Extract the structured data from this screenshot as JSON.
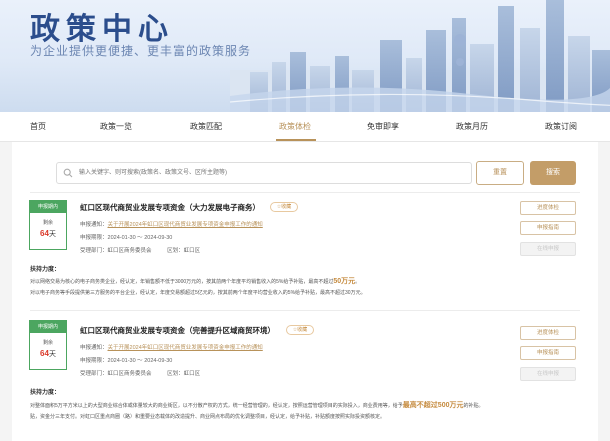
{
  "banner": {
    "title": "政策中心",
    "subtitle": "为企业提供更便捷、更丰富的政策服务"
  },
  "nav": {
    "items": [
      "首页",
      "政策一览",
      "政策匹配",
      "政策体检",
      "免审即享",
      "政策月历",
      "政策订阅"
    ],
    "active_index": 3
  },
  "search": {
    "placeholder": "输入关键字、则可搜索(政策名、政策文号、区所主题等)",
    "reset_label": "重置",
    "search_label": "搜索"
  },
  "policies": [
    {
      "status": "申报期内",
      "countdown_label": "剩余",
      "days": "64",
      "days_unit": "天",
      "title": "虹口区现代商贸业发展专项资金（大力发展电子商务）",
      "fav_label": "☆收藏",
      "notice_label": "申报通知：",
      "notice_link": "关于开展2024年虹口区现代商贸业发展专项资金申报工作的通知",
      "period_label": "申报期限：",
      "period": "2024-01-30 ～ 2024-09-30",
      "dept_label": "受理部门：",
      "dept": "虹口区商务委员会",
      "district_label": "区划：",
      "district": "虹口区",
      "support_label": "扶持力度：",
      "desc_1a": "对以网络交易为核心的电子商务类企业，经认定，年销售额不低于3000万元的，按其前两个年度平均销售收入的5%给予补贴，最高不超过",
      "desc_1b": "50万元",
      "desc_1c": "。",
      "desc_2": "对以电子商务等手段提供第三方服务的平台企业，经认定，年度交易额超过5亿元的，按其前两个年度平均营业收入的5%给予补贴，最高不超过30万元。",
      "buttons": [
        "进度体检",
        "申报指南",
        "在线申报"
      ]
    },
    {
      "status": "申报期内",
      "countdown_label": "剩余",
      "days": "64",
      "days_unit": "天",
      "title": "虹口区现代商贸业发展专项资金（完善提升区域商贸环境）",
      "fav_label": "☆收藏",
      "notice_label": "申报通知：",
      "notice_link": "关于开展2024年虹口区现代商贸业发展专项资金申报工作的通知",
      "period_label": "申报期限：",
      "period": "2024-01-30 ～ 2024-09-30",
      "dept_label": "受理部门：",
      "dept": "虹口区商务委员会",
      "district_label": "区划：",
      "district": "虹口区",
      "support_label": "扶持力度：",
      "desc_1a": "对整体面积5万平方米以上的大型商业综合体或体量较大的商业街区，以不分散产权的方式，统一经营管理的，经认定，按照运营管理项目的实际投入，商业费用等，给予",
      "desc_1b": "最高不超过500万元",
      "desc_1c": "的补贴。",
      "desc_2": "贴，资金分三年支付。对虹口区重点商圈（路）和重要业态载体的改造提升、商业网点布局的优化调整项目，经认定，给予补贴，补贴额度按照实际投资额核定。",
      "buttons": [
        "进度体检",
        "申报指南",
        "在线申报"
      ]
    }
  ]
}
